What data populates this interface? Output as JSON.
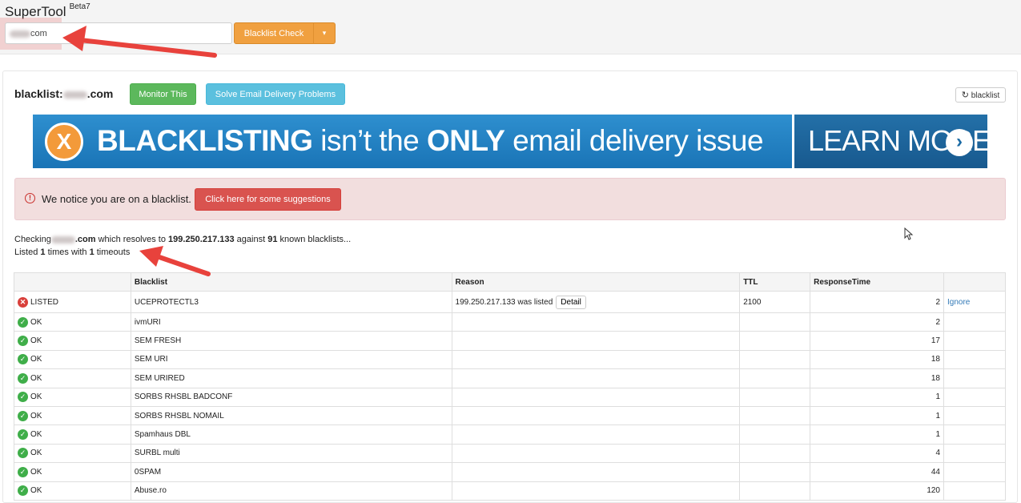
{
  "header": {
    "brand": "SuperTool",
    "version": "Beta7",
    "domain_value_suffix": "com",
    "check_label": "Blacklist Check",
    "caret": "▾"
  },
  "result": {
    "title_prefix": "blacklist:",
    "title_suffix": ".com",
    "monitor_label": "Monitor This",
    "solve_label": "Solve Email Delivery Problems",
    "refresh_label": "blacklist"
  },
  "banner": {
    "x_glyph": "X",
    "word1": "BLACKLISTING",
    "mid": " isn’t the ",
    "word2": "ONLY",
    "rest": " email delivery issue",
    "learn_more": "LEARN MORE",
    "arrow": "›"
  },
  "alert": {
    "icon": "!",
    "message": "We notice you are on a blacklist.",
    "button": "Click here for some suggestions"
  },
  "status": {
    "checking_prefix": "Checking",
    "domain_suffix": ".com",
    "resolves_text": " which resolves to ",
    "ip": "199.250.217.133",
    "against_text": " against ",
    "count": "91",
    "known_text": " known blacklists...",
    "listed_prefix": "Listed ",
    "listed_count": "1",
    "times_text": " times with ",
    "timeouts_count": "1",
    "timeouts_text": " timeouts"
  },
  "table": {
    "headers": [
      "",
      "Blacklist",
      "Reason",
      "TTL",
      "ResponseTime",
      ""
    ],
    "listed_row": {
      "status": "LISTED",
      "blacklist": "UCEPROTECTL3",
      "reason": "199.250.217.133 was listed",
      "detail": "Detail",
      "ttl": "2100",
      "response": "2",
      "action": "Ignore"
    },
    "ok_rows": [
      {
        "status": "OK",
        "blacklist": "ivmURI",
        "response": "2"
      },
      {
        "status": "OK",
        "blacklist": "SEM FRESH",
        "response": "17"
      },
      {
        "status": "OK",
        "blacklist": "SEM URI",
        "response": "18"
      },
      {
        "status": "OK",
        "blacklist": "SEM URIRED",
        "response": "18"
      },
      {
        "status": "OK",
        "blacklist": "SORBS RHSBL BADCONF",
        "response": "1"
      },
      {
        "status": "OK",
        "blacklist": "SORBS RHSBL NOMAIL",
        "response": "1"
      },
      {
        "status": "OK",
        "blacklist": "Spamhaus DBL",
        "response": "1"
      },
      {
        "status": "OK",
        "blacklist": "SURBL multi",
        "response": "4"
      },
      {
        "status": "OK",
        "blacklist": "0SPAM",
        "response": "44"
      },
      {
        "status": "OK",
        "blacklist": "Abuse.ro",
        "response": "120"
      }
    ]
  },
  "colors": {
    "accent_orange": "#f0a040",
    "success": "#5cb85c",
    "info": "#5bc0de",
    "danger": "#d9534f",
    "annotation_arrow": "#e8423c"
  }
}
